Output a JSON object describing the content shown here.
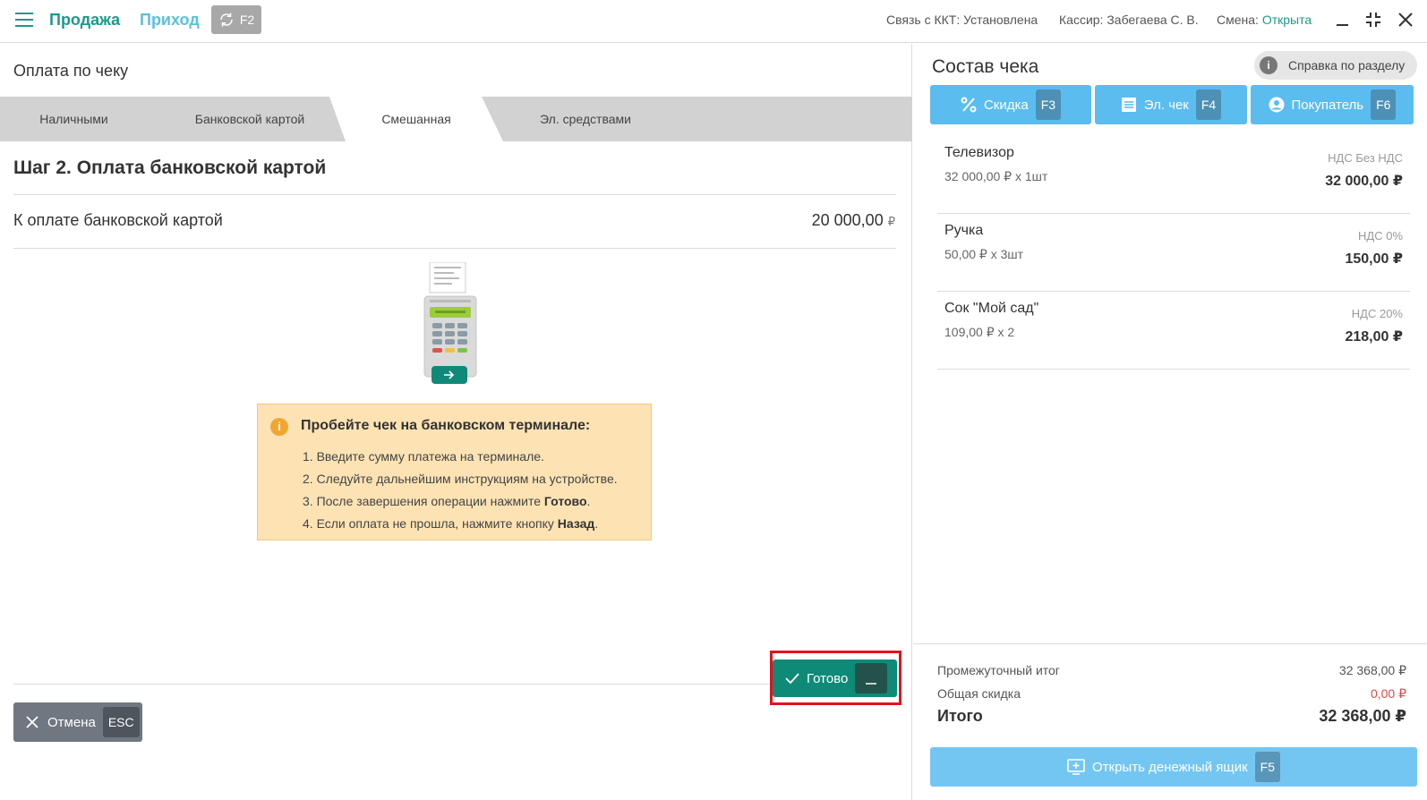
{
  "header": {
    "nav_sale": "Продажа",
    "nav_income": "Приход",
    "sync_key": "F2",
    "kkt_label": "Связь с ККТ: Установлена",
    "cashier_label": "Кассир: Забегаева С. В.",
    "shift_label": "Смена:",
    "shift_value": "Открыта"
  },
  "left": {
    "title": "Оплата по чеку",
    "tabs": [
      {
        "label": "Наличными"
      },
      {
        "label": "Банковской картой"
      },
      {
        "label": "Смешанная",
        "active": true
      },
      {
        "label": "Эл. средствами"
      }
    ],
    "step_title": "Шаг 2. Оплата банковской картой",
    "pay_label": "К оплате банковской картой",
    "pay_value": "20 000,00",
    "currency": "₽",
    "info": {
      "title": "Пробейте чек на банковском терминале:",
      "steps": [
        "1. Введите сумму платежа на терминале.",
        "2. Следуйте дальнейшим инструкциям на устройстве.",
        "3. После завершения операции нажмите ",
        "4. Если оплата не прошла, нажмите кнопку "
      ],
      "step3_bold": "Готово",
      "step4_bold": "Назад",
      "period": "."
    },
    "cancel_label": "Отмена",
    "cancel_key": "ESC",
    "done_label": "Готово"
  },
  "right": {
    "title": "Состав чека",
    "help_label": "Справка по разделу",
    "buttons": {
      "discount": {
        "label": "Скидка",
        "key": "F3"
      },
      "echeck": {
        "label": "Эл. чек",
        "key": "F4"
      },
      "buyer": {
        "label": "Покупатель",
        "key": "F6"
      }
    },
    "items": [
      {
        "name": "Телевизор",
        "price": "32 000,00 ₽ x 1шт",
        "vat": "НДС Без НДС",
        "sum": "32 000,00 ₽"
      },
      {
        "name": "Ручка",
        "price": "50,00 ₽ x 3шт",
        "vat": "НДС 0%",
        "sum": "150,00 ₽"
      },
      {
        "name": "Сок \"Мой сад\"",
        "price": "109,00 ₽ x 2",
        "vat": "НДС 20%",
        "sum": "218,00 ₽"
      }
    ],
    "subtotal_label": "Промежуточный итог",
    "subtotal_value": "32 368,00 ₽",
    "discount_label": "Общая скидка",
    "discount_value": "0,00 ₽",
    "total_label": "Итого",
    "total_value": "32 368,00 ₽",
    "drawer_label": "Открыть денежный ящик",
    "drawer_key": "F5"
  },
  "colors": {
    "accent": "#1a9a8a",
    "light_blue": "#5bbcf0",
    "done_green": "#108a78",
    "info_bg": "#fde3b4",
    "highlight_red": "#e0141e"
  }
}
